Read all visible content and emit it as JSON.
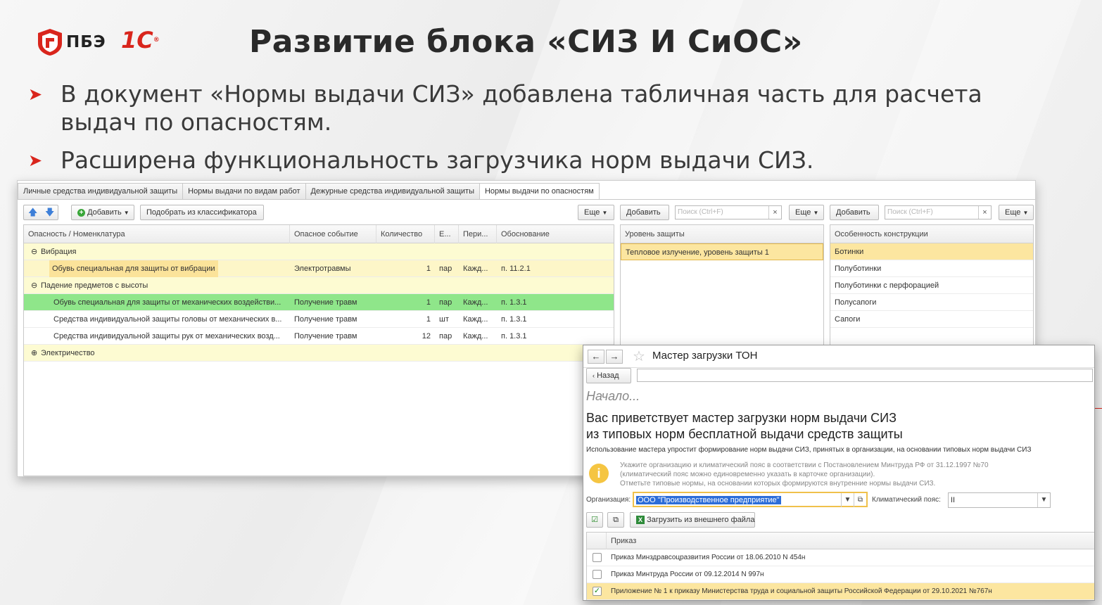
{
  "slide": {
    "logo_pbe": "ПБЭ",
    "logo_1c": "1С",
    "title": "Развитие блока «СИЗ И СиОС»",
    "bullets": [
      "В документ «Нормы выдачи СИЗ» добавлена табличная часть для расчета выдач по опасностям.",
      "Расширена функциональность загрузчика норм выдачи СИЗ."
    ],
    "colors": {
      "accent": "#d9251c"
    }
  },
  "main_window": {
    "tabs": [
      "Личные средства индивидуальной защиты",
      "Нормы выдачи по видам работ",
      "Дежурные средства индивидуальной защиты",
      "Нормы выдачи по опасностям"
    ],
    "active_tab": 3,
    "toolbar": {
      "add_label": "Добавить",
      "pick_label": "Подобрать из классификатора",
      "more_label": "Еще"
    },
    "left_table": {
      "headers": [
        "Опасность / Номенклатура",
        "Опасное событие",
        "Количество",
        "Е...",
        "Пери...",
        "Обоснование"
      ],
      "rows": [
        {
          "type": "group",
          "name": "Вибрация"
        },
        {
          "type": "item",
          "name": "Обувь специальная для защиты от вибрации",
          "event": "Электротравмы",
          "qty": "1",
          "unit": "пар",
          "period": "Кажд...",
          "basis": "п. 11.2.1"
        },
        {
          "type": "group",
          "name": "Падение предметов с высоты"
        },
        {
          "type": "item",
          "name": "Обувь специальная для защиты от механических воздействи...",
          "event": "Получение травм",
          "qty": "1",
          "unit": "пар",
          "period": "Кажд...",
          "basis": "п. 1.3.1"
        },
        {
          "type": "item",
          "name": "Средства индивидуальной защиты головы от механических в...",
          "event": "Получение травм",
          "qty": "1",
          "unit": "шт",
          "period": "Кажд...",
          "basis": "п. 1.3.1"
        },
        {
          "type": "item",
          "name": "Средства индивидуальной защиты рук от механических возд...",
          "event": "Получение травм",
          "qty": "12",
          "unit": "пар",
          "period": "Кажд...",
          "basis": "п. 1.3.1"
        },
        {
          "type": "group",
          "name": "Электричество"
        }
      ]
    },
    "middle_panel": {
      "add_label": "Добавить",
      "search_placeholder": "Поиск (Ctrl+F)",
      "more_label": "Еще",
      "header": "Уровень защиты",
      "rows": [
        "Тепловое излучение, уровень защиты 1"
      ]
    },
    "right_panel": {
      "add_label": "Добавить",
      "search_placeholder": "Поиск (Ctrl+F)",
      "more_label": "Еще",
      "header": "Особенность конструкции",
      "rows": [
        "Ботинки",
        "Полуботинки",
        "Полуботинки с перфорацией",
        "Полусапоги",
        "Сапоги"
      ]
    }
  },
  "wizard": {
    "title": "Мастер загрузки ТОН",
    "back_label": "Назад",
    "step": "Начало...",
    "heading_line1": "Вас приветствует мастер загрузки норм выдачи СИЗ",
    "heading_line2": "из типовых норм бесплатной выдачи средств защиты",
    "description": "Использование мастера упростит формирование норм выдачи СИЗ, принятых в организации, на основании типовых норм выдачи СИЗ",
    "info_lines": [
      "Укажите организацию и климатический пояс в соответствии с Постановлением Минтруда РФ от 31.12.1997 №70",
      "(климатический пояс можно единовременно указать в карточке организации).",
      "Отметьте типовые нормы, на основании которых формируются внутренние нормы выдачи СИЗ."
    ],
    "org_label": "Организация:",
    "org_value": "ООО \"Производственное предприятие\"",
    "climate_label": "Климатический пояс:",
    "climate_value": "II",
    "load_file_label": "Загрузить из внешнего файла",
    "table_header": "Приказ",
    "orders": [
      {
        "name": "Приказ Минздравсоцразвития России от 18.06.2010 N 454н",
        "checked": false
      },
      {
        "name": "Приказ Минтруда России от 09.12.2014 N 997н",
        "checked": false
      },
      {
        "name": "Приложение № 1 к приказу Министерства труда и социальной защиты Российской Федерации от 29.10.2021 №767н",
        "checked": true
      }
    ]
  }
}
